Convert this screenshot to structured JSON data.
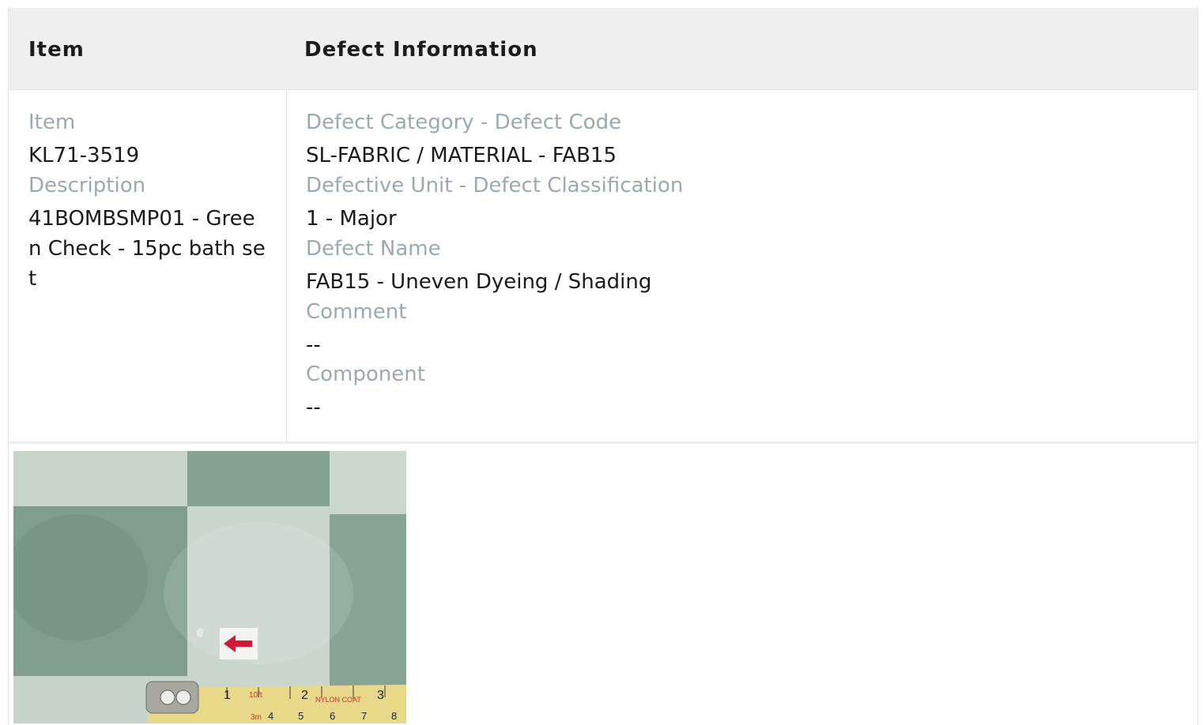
{
  "table": {
    "headers": {
      "item": "Item",
      "defect_information": "Defect Information"
    },
    "item": {
      "item_label": "Item",
      "item_value": "KL71-3519",
      "description_label": "Description",
      "description_value": "41BOMBSMP01 - Green Check - 15pc bath set"
    },
    "defect": {
      "category_code_label": "Defect Category - Defect Code",
      "category_code_value": "SL-FABRIC / MATERIAL - FAB15",
      "unit_classification_label": "Defective Unit - Defect Classification",
      "unit_classification_value": "1 - Major",
      "name_label": "Defect Name",
      "name_value": "FAB15 - Uneven Dyeing / Shading",
      "comment_label": "Comment",
      "comment_value": "--",
      "component_label": "Component",
      "component_value": "--"
    }
  },
  "photo": {
    "tape_marks": [
      "1",
      "2",
      "3",
      "10ft",
      "3m",
      "4",
      "5",
      "6",
      "7",
      "8",
      "NYLON COAT"
    ]
  },
  "colors": {
    "header_bg": "#efefef",
    "label": "#9aa9b2",
    "value": "#1a1a1a",
    "fabric_dark": "#7f9f8c",
    "fabric_light": "#c9d6cc",
    "tape": "#e8d98a",
    "arrow": "#d11a35"
  }
}
